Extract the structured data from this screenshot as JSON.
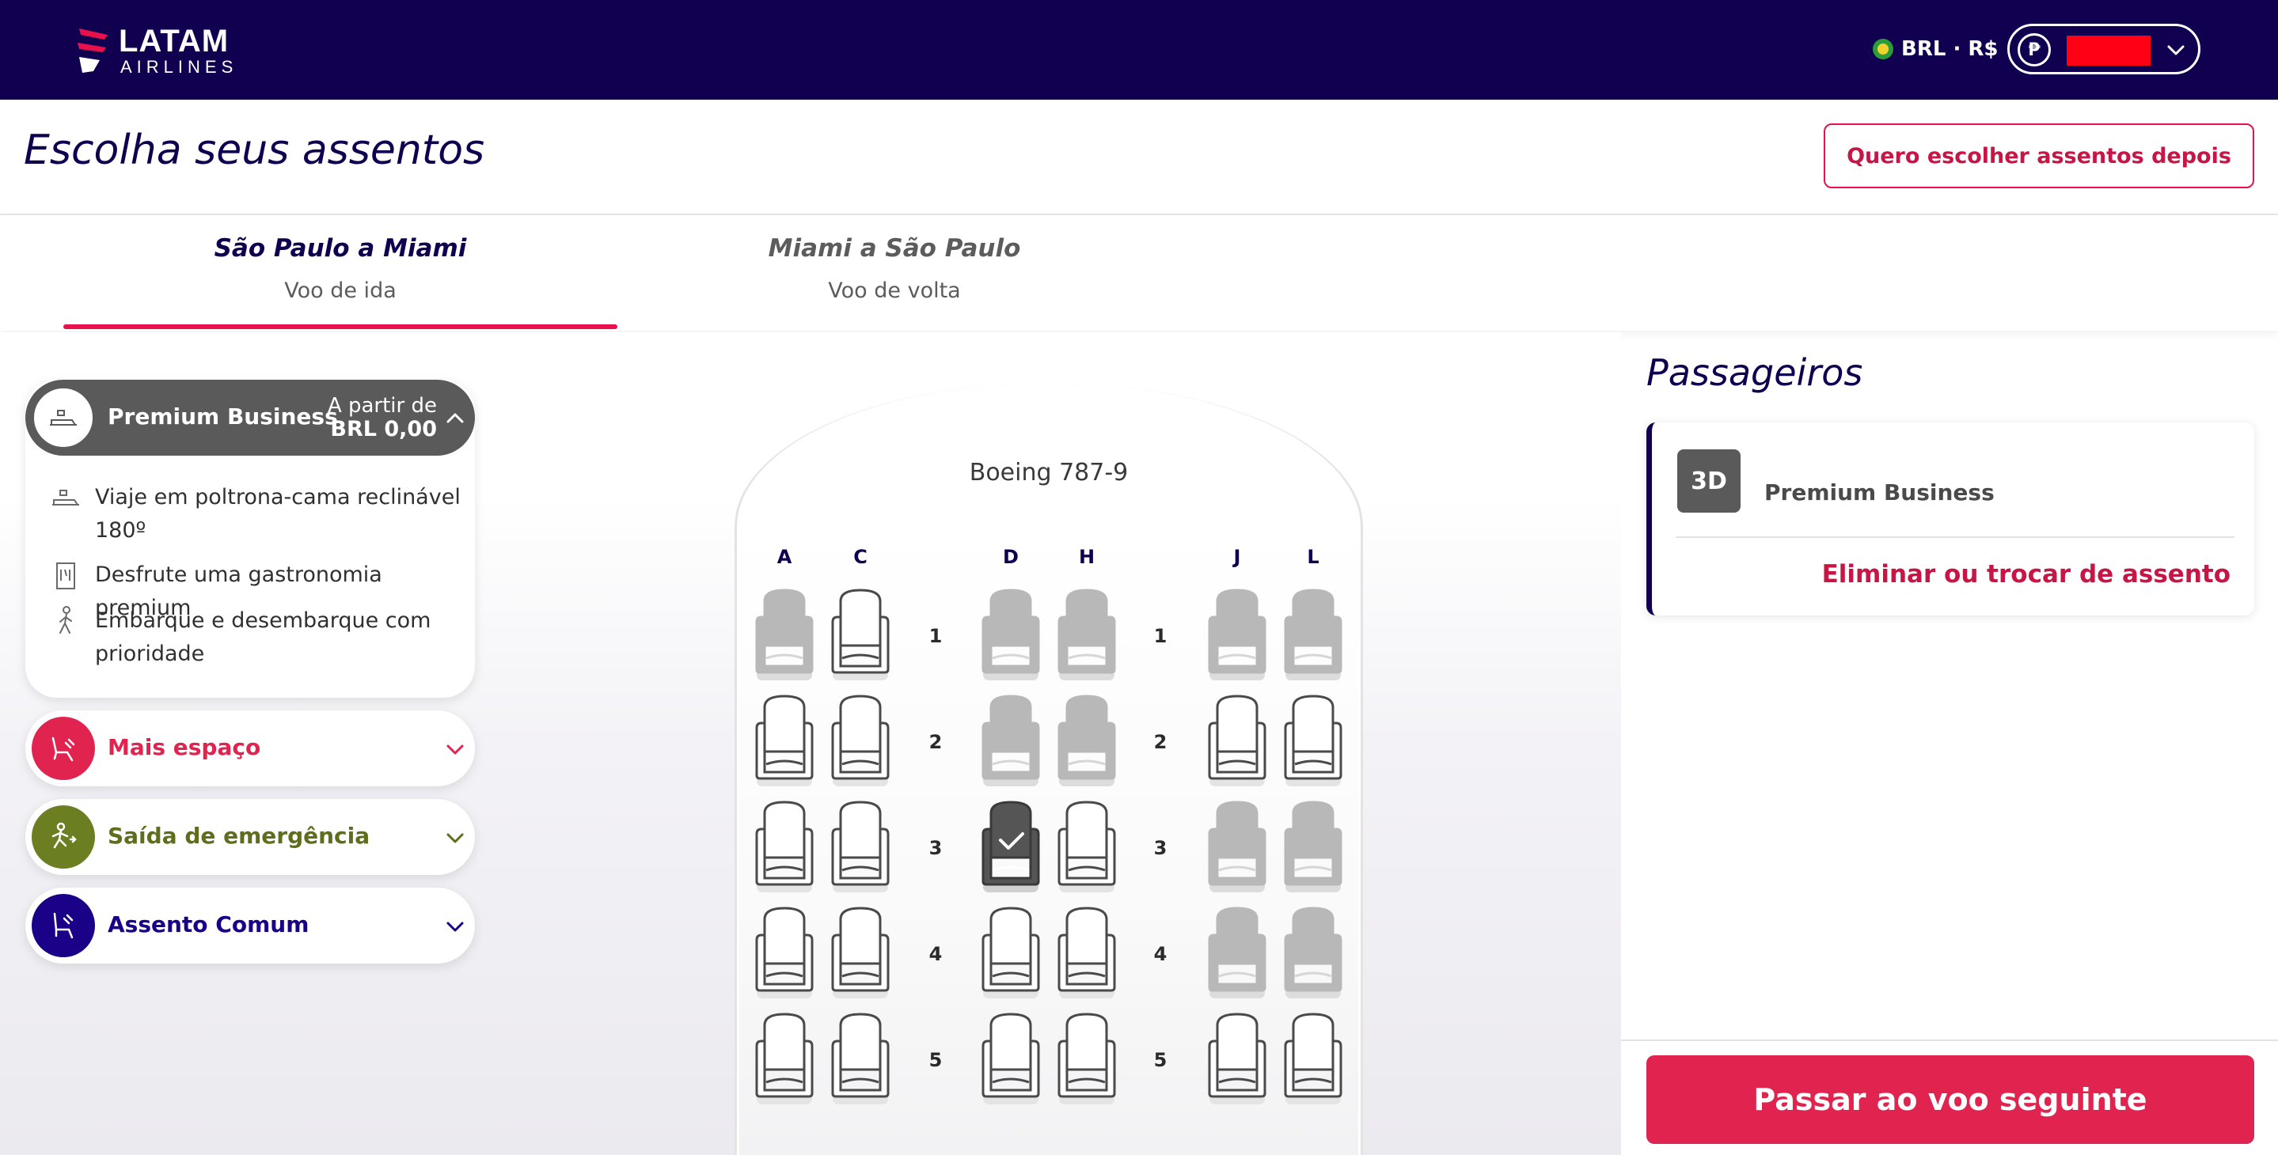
{
  "header": {
    "logo_word": "LATAM",
    "logo_sub": "AIRLINES",
    "currency": "BRL · R$",
    "account_icon": "₱"
  },
  "page": {
    "title": "Escolha seus assentos",
    "later_button": "Quero escolher assentos depois"
  },
  "tabs": [
    {
      "route": "São Paulo a Miami",
      "direction": "Voo de ida",
      "active": true
    },
    {
      "route": "Miami a São Paulo",
      "direction": "Voo de volta",
      "active": false
    }
  ],
  "cabin": {
    "name": "Premium Business",
    "from_label": "A partir de",
    "from_price": "BRL 0,00",
    "features": [
      {
        "icon": "flat-bed-icon",
        "text": "Viaje em poltrona-cama reclinável 180º"
      },
      {
        "icon": "menu-card-icon",
        "text": "Desfrute uma gastronomia premium"
      },
      {
        "icon": "walking-person-icon",
        "text": "Embarque e desembarque com prioridade"
      }
    ]
  },
  "categories": [
    {
      "label": "Mais espaço",
      "color": "#e0234f",
      "icon": "extra-legroom-icon"
    },
    {
      "label": "Saída de emergência",
      "color": "#6b7f22",
      "icon": "emergency-exit-icon"
    },
    {
      "label": "Assento Comum",
      "color": "#1b0088",
      "icon": "standard-seat-icon"
    }
  ],
  "seatmap": {
    "aircraft": "Boeing 787-9",
    "columns": [
      "A",
      "C",
      "D",
      "H",
      "J",
      "L"
    ],
    "rows": [
      {
        "number": "1",
        "seats": [
          "occupied",
          "available",
          "occupied",
          "occupied",
          "occupied",
          "occupied"
        ]
      },
      {
        "number": "2",
        "seats": [
          "available",
          "available",
          "occupied",
          "occupied",
          "available",
          "available"
        ]
      },
      {
        "number": "3",
        "seats": [
          "available",
          "available",
          "selected",
          "available",
          "occupied",
          "occupied"
        ]
      },
      {
        "number": "4",
        "seats": [
          "available",
          "available",
          "available",
          "available",
          "occupied",
          "occupied"
        ]
      },
      {
        "number": "5",
        "seats": [
          "available",
          "available",
          "available",
          "available",
          "available",
          "available"
        ]
      }
    ]
  },
  "passengers": {
    "title": "Passageiros",
    "seat": "3D",
    "class": "Premium Business",
    "change_link": "Eliminar ou trocar de assento"
  },
  "next_button": "Passar ao voo seguinte",
  "colors": {
    "header_bg": "#10004f",
    "accent": "#e8114b",
    "cabin_gray": "#5a5a5a"
  }
}
